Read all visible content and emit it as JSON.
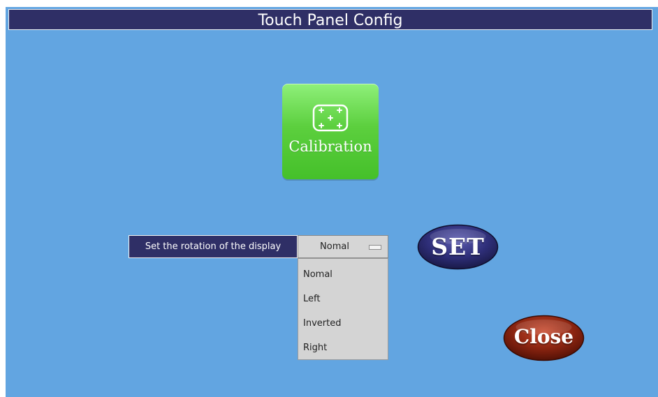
{
  "window": {
    "title": "Touch Panel Config"
  },
  "calibration": {
    "label": "Calibration",
    "icon": "calibration-crosshair-icon"
  },
  "rotation": {
    "label": "Set the rotation of the display",
    "selected": "Nomal",
    "options": [
      "Nomal",
      "Left",
      "Inverted",
      "Right"
    ]
  },
  "buttons": {
    "set_label": "SET",
    "close_label": "Close"
  },
  "colors": {
    "background": "#62a5e1",
    "titlebar": "#2f2f66",
    "calibration_green": "#5ccf3e",
    "set_blue": "#2c2c6e",
    "close_red": "#7a1c0e"
  }
}
